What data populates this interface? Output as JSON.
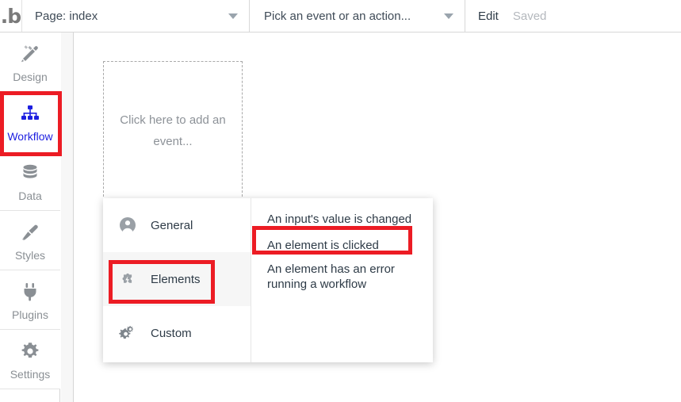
{
  "topbar": {
    "logo": "bubble-logo",
    "page_select": {
      "value": "Page: index",
      "caret": "chevron-down-icon"
    },
    "event_select": {
      "value": "Pick an event or an action...",
      "caret": "chevron-down-icon"
    },
    "edit_label": "Edit",
    "saved_label": "Saved"
  },
  "sidebar": {
    "items": [
      {
        "label": "Design",
        "icon": "design-pencil-icon",
        "active": false
      },
      {
        "label": "Workflow",
        "icon": "workflow-nodes-icon",
        "active": true
      },
      {
        "label": "Data",
        "icon": "database-icon",
        "active": false
      },
      {
        "label": "Styles",
        "icon": "paintbrush-icon",
        "active": false
      },
      {
        "label": "Plugins",
        "icon": "plug-icon",
        "active": false
      },
      {
        "label": "Settings",
        "icon": "gear-icon",
        "active": false
      }
    ]
  },
  "canvas": {
    "placeholder": {
      "text": "Click here to add an event..."
    }
  },
  "menu": {
    "categories": [
      {
        "label": "General",
        "icon": "person-circle-icon",
        "selected": false
      },
      {
        "label": "Elements",
        "icon": "puzzle-bolt-icon",
        "selected": true
      },
      {
        "label": "Custom",
        "icon": "gears-icon",
        "selected": false
      }
    ],
    "events": [
      {
        "label": "An input's value is changed",
        "highlighted": false
      },
      {
        "label": "An element is clicked",
        "highlighted": true
      },
      {
        "label": "An element has an error running a workflow",
        "highlighted": false
      }
    ]
  },
  "annotations": {
    "color": "#ec1c24",
    "boxes": [
      "workflow-sidebar-item",
      "elements-category-row",
      "an-element-is-clicked-row"
    ]
  }
}
